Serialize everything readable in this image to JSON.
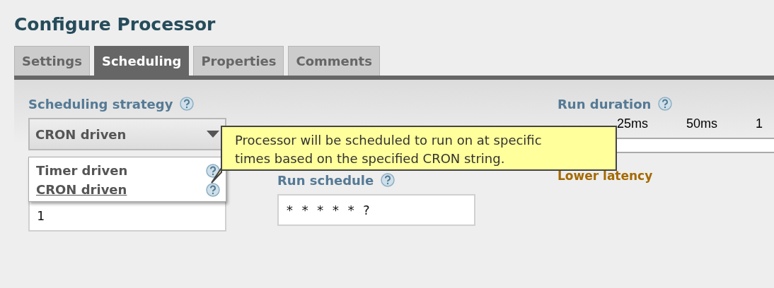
{
  "title": "Configure Processor",
  "tabs": [
    {
      "label": "Settings",
      "selected": false
    },
    {
      "label": "Scheduling",
      "selected": true
    },
    {
      "label": "Properties",
      "selected": false
    },
    {
      "label": "Comments",
      "selected": false
    }
  ],
  "scheduling_strategy": {
    "label": "Scheduling strategy",
    "value": "CRON driven",
    "expanded": true,
    "options": [
      {
        "label": "Timer driven",
        "selected": false
      },
      {
        "label": "CRON driven",
        "selected": true
      }
    ]
  },
  "concurrent_tasks": {
    "value": "1"
  },
  "run_schedule": {
    "label": "Run schedule",
    "value": "* * * * * ?"
  },
  "run_duration": {
    "label": "Run duration",
    "ticks": [
      "25ms",
      "50ms",
      "1"
    ],
    "caption": "Lower latency"
  },
  "tooltip": "Processor will be scheduled to run on at specific times based on the specified CRON string."
}
